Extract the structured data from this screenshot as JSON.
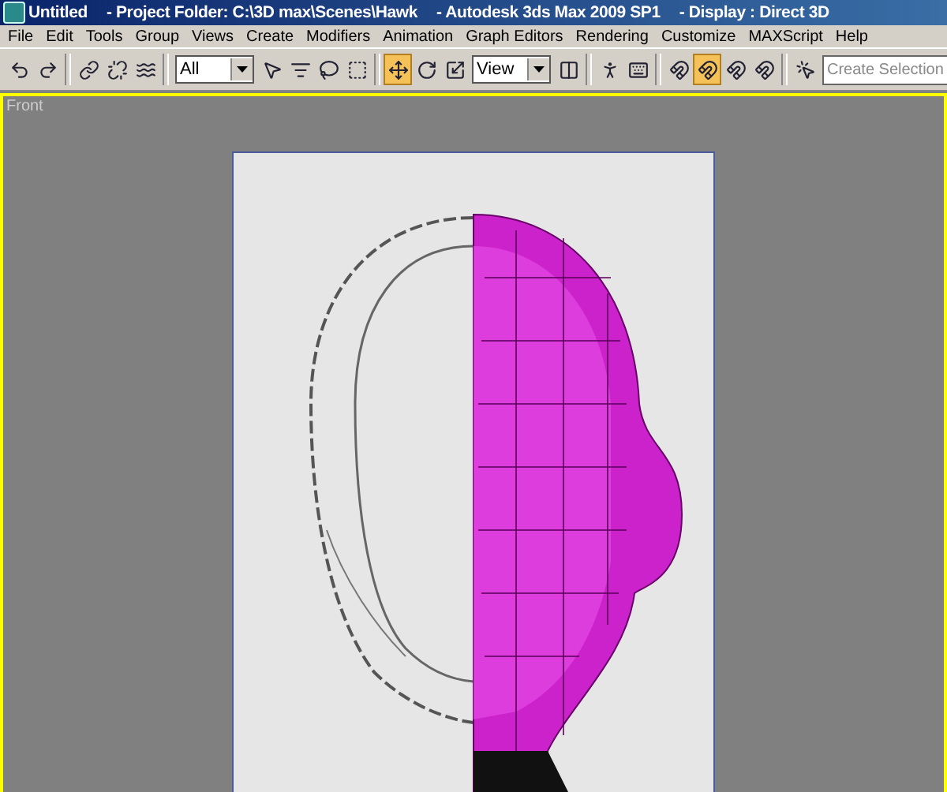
{
  "window": {
    "title": "Untitled",
    "project": "- Project Folder: C:\\3D max\\Scenes\\Hawk",
    "app": "- Autodesk 3ds Max  2009 SP1",
    "display": "- Display : Direct 3D"
  },
  "menu": [
    "File",
    "Edit",
    "Tools",
    "Group",
    "Views",
    "Create",
    "Modifiers",
    "Animation",
    "Graph Editors",
    "Rendering",
    "Customize",
    "MAXScript",
    "Help"
  ],
  "toolbar": [
    {
      "kind": "button",
      "selected": false
    },
    {
      "kind": "button",
      "selected": false
    },
    {
      "kind": "separator"
    },
    {
      "kind": "button",
      "selected": false
    },
    {
      "kind": "button",
      "selected": false
    },
    {
      "kind": "button",
      "selected": false
    },
    {
      "kind": "separator"
    },
    {
      "kind": "dropdown",
      "value": "All"
    },
    {
      "kind": "button",
      "selected": false
    },
    {
      "kind": "button",
      "selected": false
    },
    {
      "kind": "button",
      "selected": false
    },
    {
      "kind": "button",
      "selected": false
    },
    {
      "kind": "separator"
    },
    {
      "kind": "button",
      "selected": true
    },
    {
      "kind": "button",
      "selected": false
    },
    {
      "kind": "button",
      "selected": false
    },
    {
      "kind": "dropdown",
      "value": "View"
    },
    {
      "kind": "button",
      "selected": false
    },
    {
      "kind": "separator"
    },
    {
      "kind": "button",
      "selected": false
    },
    {
      "kind": "button",
      "selected": false
    },
    {
      "kind": "separator"
    },
    {
      "kind": "button",
      "selected": false
    },
    {
      "kind": "button",
      "selected": true
    },
    {
      "kind": "button",
      "selected": false
    },
    {
      "kind": "button",
      "selected": false
    },
    {
      "kind": "separator"
    },
    {
      "kind": "button",
      "selected": false
    },
    {
      "kind": "field",
      "placeholder": "Create Selection"
    }
  ],
  "viewport": {
    "label": "Front",
    "active": true
  }
}
